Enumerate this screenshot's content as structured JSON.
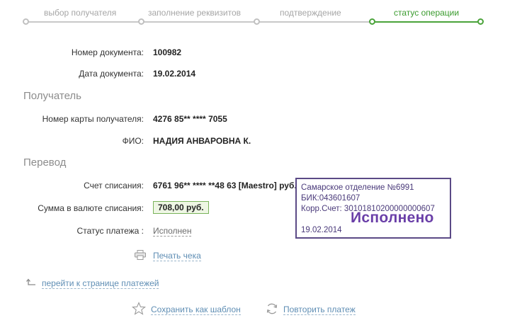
{
  "steps": [
    {
      "label": "выбор получателя",
      "active": false
    },
    {
      "label": "заполнение реквизитов",
      "active": false
    },
    {
      "label": "подтверждение",
      "active": false
    },
    {
      "label": "статус операции",
      "active": true
    }
  ],
  "document": {
    "number_label": "Номер документа:",
    "number": "100982",
    "date_label": "Дата документа:",
    "date": "19.02.2014"
  },
  "recipient": {
    "title": "Получатель",
    "card_label": "Номер карты получателя:",
    "card": "4276 85** **** 7055",
    "name_label": "ФИО:",
    "name": "НАДИЯ АНВАРОВНА К."
  },
  "transfer": {
    "title": "Перевод",
    "account_label": "Счет списания:",
    "account": "6761 96** **** **48 63  [Maestro]  руб.",
    "amount_label": "Сумма в валюте списания:",
    "amount": "708,00  руб.",
    "status_label": "Статус платежа :",
    "status": "Исполнен"
  },
  "actions": {
    "print": "Печать чека",
    "back": "перейти к странице платежей",
    "save_template": "Сохранить как шаблон",
    "repeat": "Повторить платеж"
  },
  "stamp": {
    "branch": "Самарское отделение №6991",
    "bik": "БИК:043601607",
    "corr": "Корр.Счет: 30101810200000000607",
    "status": "Исполнено",
    "date": "19.02.2014"
  },
  "colors": {
    "accent_green": "#4aa33a",
    "link_blue": "#5f8eb4",
    "stamp_purple": "#5b4a86"
  }
}
